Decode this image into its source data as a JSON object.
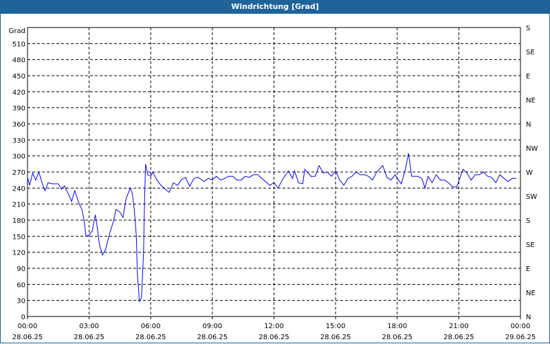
{
  "window": {
    "title": "Windrichtung [Grad]"
  },
  "chart_data": {
    "type": "line",
    "title": "Windrichtung [Grad]",
    "ylabel": "Grad",
    "ylim": [
      0,
      540
    ],
    "yticks": [
      0,
      30,
      60,
      90,
      120,
      150,
      180,
      210,
      240,
      270,
      300,
      330,
      360,
      390,
      420,
      450,
      480,
      510
    ],
    "right_axis": {
      "values": [
        0,
        45,
        90,
        135,
        180,
        225,
        270,
        315,
        360,
        405,
        450,
        495,
        540
      ],
      "labels": [
        "N",
        "NE",
        "E",
        "SE",
        "S",
        "SW",
        "W",
        "NW",
        "N",
        "NE",
        "E",
        "SE",
        "S"
      ]
    },
    "xlim_hours": [
      0,
      24
    ],
    "xticks": [
      {
        "h": 0,
        "time": "00:00",
        "date": "28.06.25"
      },
      {
        "h": 3,
        "time": "03:00",
        "date": "28.06.25"
      },
      {
        "h": 6,
        "time": "06:00",
        "date": "28.06.25"
      },
      {
        "h": 9,
        "time": "09:00",
        "date": "28.06.25"
      },
      {
        "h": 12,
        "time": "12:00",
        "date": "28.06.25"
      },
      {
        "h": 15,
        "time": "15:00",
        "date": "28.06.25"
      },
      {
        "h": 18,
        "time": "18:00",
        "date": "28.06.25"
      },
      {
        "h": 21,
        "time": "21:00",
        "date": "28.06.25"
      },
      {
        "h": 24,
        "time": "00:00",
        "date": "29.06.25"
      }
    ],
    "grid": true,
    "series": [
      {
        "name": "Windrichtung",
        "color": "#0000ff",
        "x": [
          0,
          0.1,
          0.25,
          0.4,
          0.55,
          0.75,
          0.85,
          1.0,
          1.2,
          1.5,
          1.65,
          1.8,
          2.0,
          2.15,
          2.3,
          2.5,
          2.65,
          2.75,
          2.85,
          3.0,
          3.15,
          3.3,
          3.4,
          3.5,
          3.65,
          3.8,
          4.0,
          4.2,
          4.3,
          4.5,
          4.65,
          4.8,
          5.0,
          5.1,
          5.2,
          5.3,
          5.35,
          5.45,
          5.55,
          5.65,
          5.7,
          5.75,
          5.85,
          6.0,
          6.1,
          6.3,
          6.5,
          6.7,
          6.9,
          7.1,
          7.3,
          7.5,
          7.7,
          7.9,
          8.1,
          8.3,
          8.5,
          8.6,
          8.8,
          9.0,
          9.2,
          9.4,
          9.6,
          9.8,
          10.0,
          10.2,
          10.4,
          10.6,
          10.8,
          11.0,
          11.2,
          11.5,
          11.8,
          12.0,
          12.2,
          12.4,
          12.7,
          12.9,
          13.0,
          13.2,
          13.4,
          13.5,
          13.8,
          14.0,
          14.2,
          14.4,
          14.6,
          14.8,
          15.0,
          15.2,
          15.4,
          15.6,
          15.8,
          16.0,
          16.2,
          16.4,
          16.6,
          16.8,
          17.0,
          17.3,
          17.5,
          17.7,
          17.9,
          18.0,
          18.2,
          18.4,
          18.55,
          18.7,
          19.0,
          19.2,
          19.35,
          19.5,
          19.7,
          19.9,
          20.1,
          20.3,
          20.5,
          20.7,
          20.9,
          21.2,
          21.4,
          21.6,
          21.8,
          22.0,
          22.2,
          22.4,
          22.6,
          22.8,
          23.0,
          23.2,
          23.4,
          23.6,
          23.8
        ],
        "y": [
          260,
          245,
          268,
          255,
          270,
          245,
          235,
          250,
          248,
          248,
          238,
          244,
          228,
          215,
          235,
          212,
          200,
          180,
          150,
          152,
          160,
          190,
          165,
          135,
          115,
          125,
          155,
          180,
          200,
          195,
          185,
          220,
          240,
          230,
          200,
          150,
          80,
          28,
          35,
          120,
          220,
          285,
          265,
          262,
          270,
          255,
          245,
          238,
          232,
          250,
          245,
          256,
          260,
          243,
          258,
          260,
          255,
          252,
          258,
          255,
          262,
          255,
          258,
          262,
          262,
          255,
          255,
          262,
          260,
          265,
          265,
          255,
          245,
          250,
          240,
          255,
          272,
          258,
          272,
          250,
          248,
          275,
          262,
          262,
          282,
          268,
          270,
          262,
          272,
          255,
          245,
          258,
          262,
          270,
          265,
          265,
          262,
          255,
          270,
          282,
          260,
          255,
          265,
          258,
          248,
          275,
          305,
          262,
          262,
          258,
          240,
          262,
          250,
          265,
          255,
          255,
          250,
          242,
          242,
          275,
          268,
          255,
          265,
          265,
          270,
          262,
          260,
          250,
          265,
          258,
          252,
          258,
          258
        ]
      }
    ]
  }
}
